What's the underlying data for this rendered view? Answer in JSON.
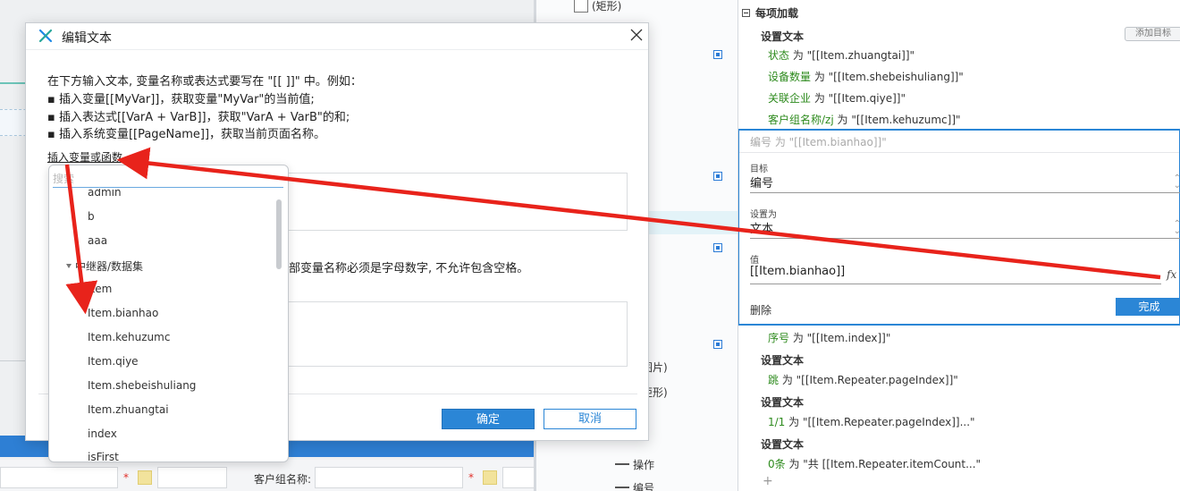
{
  "dialog": {
    "title": "编辑文本",
    "instructions": [
      "在下方输入文本, 变量名称或表达式要写在 \"[[ ]]\" 中。例如：",
      "▪ 插入变量[[MyVar]]，获取变量\"MyVar\"的当前值;",
      "▪ 插入表达式[[VarA + VarB]]，获取\"VarA + VarB\"的和;",
      "▪ 插入系统变量[[PageName]]，获取当前页面名称。"
    ],
    "insert_link": "插入变量或函数",
    "var_note": "部变量名称必须是字母数字, 不允许包含空格。",
    "ok_label": "确定",
    "cancel_label": "取消"
  },
  "dropdown": {
    "search_placeholder": "搜索",
    "items_before": [
      "admin",
      "b",
      "aaa"
    ],
    "group_label": "中继器/数据集",
    "items_after": [
      "Item",
      "Item.bianhao",
      "Item.kehuzumc",
      "Item.qiye",
      "Item.shebeishuliang",
      "Item.zhuangtai",
      "index",
      "isFirst"
    ]
  },
  "right_panel": {
    "section_title": "每项加载",
    "add_target_label": "添加目标",
    "set_text_label": "设置文本",
    "rules": [
      {
        "k": "状态",
        "w": " 为 \"[[Item.zhuangtai]]\""
      },
      {
        "k": "设备数量",
        "w": " 为 \"[[Item.shebeishuliang]]\""
      },
      {
        "k": "关联企业",
        "w": " 为 \"[[Item.qiye]]\""
      },
      {
        "k": "客户组名称/zj",
        "w": " 为 \"[[Item.kehuzumc]]\""
      }
    ],
    "editor": {
      "header": "编号 为 \"[[Item.bianhao]]\"",
      "target_label": "目标",
      "target_value": "编号",
      "set_as_label": "设置为",
      "set_as_value": "文本",
      "value_label": "值",
      "value_text": "[[Item.bianhao]]",
      "fx": "fx",
      "delete_label": "删除",
      "done_label": "完成"
    },
    "rules_after": [
      {
        "k": "序号",
        "w": " 为 \"[[Item.index]]\""
      }
    ],
    "set_text_2": "设置文本",
    "rule_page": {
      "k": "跳",
      "w": " 为 \"[[Item.Repeater.pageIndex]]\""
    },
    "set_text_3": "设置文本",
    "rule_ratio": {
      "k": "1/1",
      "w": " 为 \"[[Item.Repeater.pageIndex]]...\""
    },
    "set_text_4": "设置文本",
    "rule_count": {
      "k": "0条",
      "w": " 为 \"共 [[Item.Repeater.itemCount...\""
    },
    "plus": "+"
  },
  "mid_strip": {
    "checkbox_label": "(矩形)",
    "frag_image": "图片)",
    "frag_rect": "矩形)",
    "item_action": "操作",
    "item_number": "编号"
  },
  "background_form": {
    "label": "客户组名称:",
    "star": "*"
  },
  "colors": {
    "accent": "#2b86d6",
    "arrow": "#e8231b",
    "keyword_green": "#2e8b1e"
  }
}
